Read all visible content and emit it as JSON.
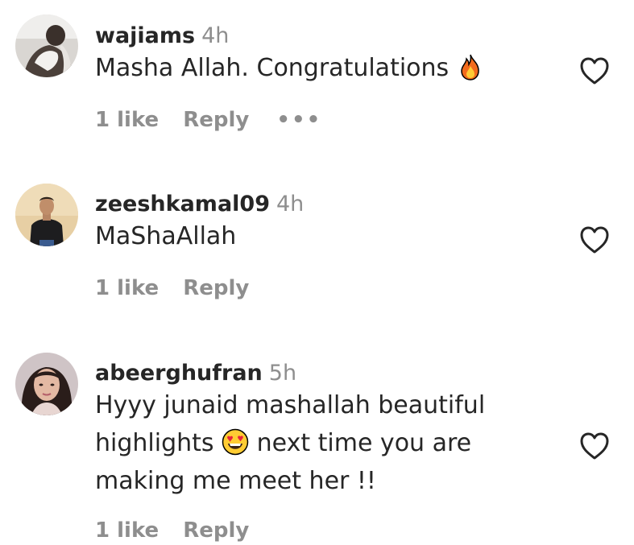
{
  "comments": [
    {
      "username": "wajiams",
      "time": "4h",
      "text": "Masha Allah. Congratulations",
      "emoji": "fire-emoji",
      "likes": "1 like",
      "reply": "Reply",
      "more": "•••"
    },
    {
      "username": "zeeshkamal09",
      "time": "4h",
      "text": "MaShaAllah",
      "likes": "1 like",
      "reply": "Reply"
    },
    {
      "username": "abeerghufran",
      "time": "5h",
      "text_line1": "Hyyy junaid mashallah beautiful",
      "text_line2_before": "highlights",
      "emoji": "heart-eyes-emoji",
      "text_line2_after": "next time you are",
      "text_line3": "making me meet her !!",
      "likes": "1 like",
      "reply": "Reply"
    }
  ],
  "icons": {
    "heart": "heart-outline-icon",
    "more": "more-options-icon"
  },
  "colors": {
    "text": "#262626",
    "secondary": "#8e8e8e",
    "background": "#ffffff"
  }
}
